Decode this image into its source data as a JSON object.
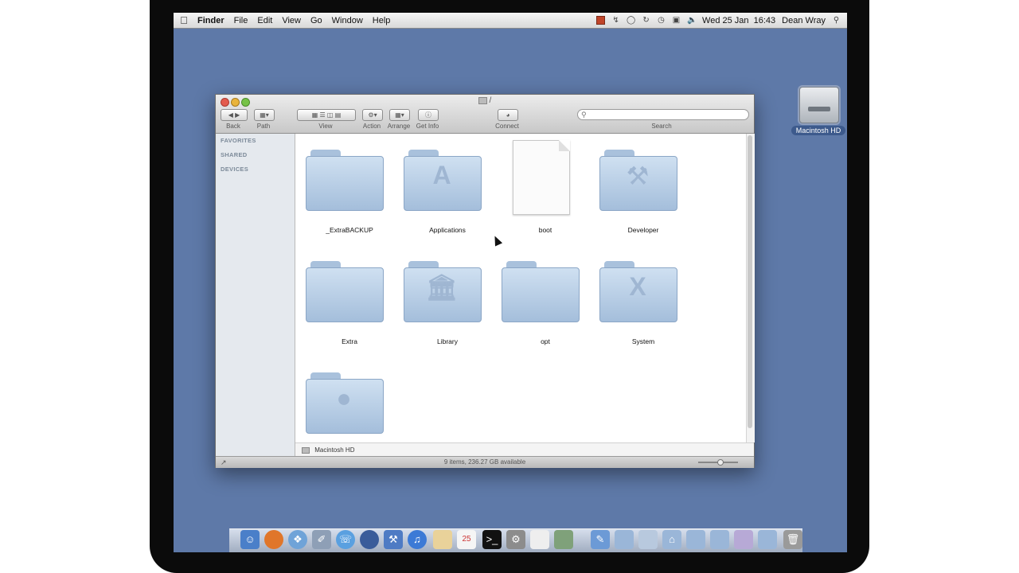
{
  "menubar": {
    "items": [
      "Finder",
      "File",
      "Edit",
      "View",
      "Go",
      "Window",
      "Help"
    ],
    "clock": "Wed 25 Jan  16:43",
    "user": "Dean Wray"
  },
  "desktop": {
    "hd_label": "Macintosh HD"
  },
  "window": {
    "title": "/",
    "toolbar": {
      "back_label": "Back",
      "path_label": "Path",
      "view_label": "View",
      "action_label": "Action",
      "arrange_label": "Arrange",
      "getinfo_label": "Get Info",
      "connect_label": "Connect",
      "search_label": "Search"
    },
    "sidebar": {
      "favorites": "FAVORITES",
      "shared": "SHARED",
      "devices": "DEVICES"
    },
    "items": [
      {
        "label": "_ExtraBACKUP",
        "icon": "folder-icon"
      },
      {
        "label": "Applications",
        "icon": "applications-folder-icon"
      },
      {
        "label": "boot",
        "icon": "document-icon"
      },
      {
        "label": "Developer",
        "icon": "developer-folder-icon"
      },
      {
        "label": "Extra",
        "icon": "folder-icon"
      },
      {
        "label": "Library",
        "icon": "library-folder-icon"
      },
      {
        "label": "opt",
        "icon": "folder-icon"
      },
      {
        "label": "System",
        "icon": "system-folder-icon"
      },
      {
        "label": "",
        "icon": "users-folder-icon"
      }
    ],
    "path_bar": "Macintosh HD",
    "status": "9 items, 236.27 GB available"
  },
  "dock": {
    "icons": [
      "finder-icon",
      "firefox-icon",
      "safari-icon",
      "preview-icon",
      "ichat-icon",
      "network-icon",
      "xcode-icon",
      "itunes-icon",
      "notes-icon",
      "calendar-icon",
      "terminal-icon",
      "system-preferences-icon",
      "textedit-icon",
      "photo-icon",
      "downloads-icon",
      "folder-icon",
      "applications-icon",
      "home-icon",
      "folder-icon",
      "folder-icon",
      "folder-icon",
      "folder-icon",
      "trash-icon"
    ]
  }
}
